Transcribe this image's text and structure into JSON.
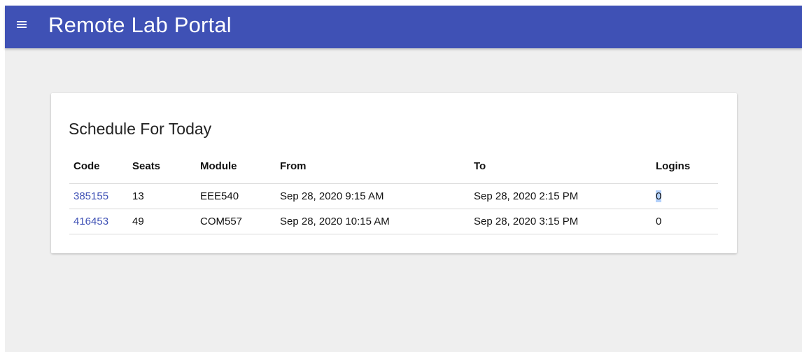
{
  "header": {
    "title": "Remote Lab Portal",
    "menu_icon": "hamburger-menu-icon",
    "color": "#3f51b5"
  },
  "card": {
    "title": "Schedule For Today"
  },
  "table": {
    "columns": [
      "Code",
      "Seats",
      "Module",
      "From",
      "To",
      "Logins"
    ],
    "rows": [
      {
        "code": "385155",
        "seats": "13",
        "module": "EEE540",
        "from": "Sep 28, 2020 9:15 AM",
        "to": "Sep 28, 2020 2:15 PM",
        "logins": "0"
      },
      {
        "code": "416453",
        "seats": "49",
        "module": "COM557",
        "from": "Sep 28, 2020 10:15 AM",
        "to": "Sep 28, 2020 3:15 PM",
        "logins": "0"
      }
    ]
  },
  "colors": {
    "link": "#3f51b5",
    "background": "#efefef",
    "selection": "#b4d1fb"
  }
}
